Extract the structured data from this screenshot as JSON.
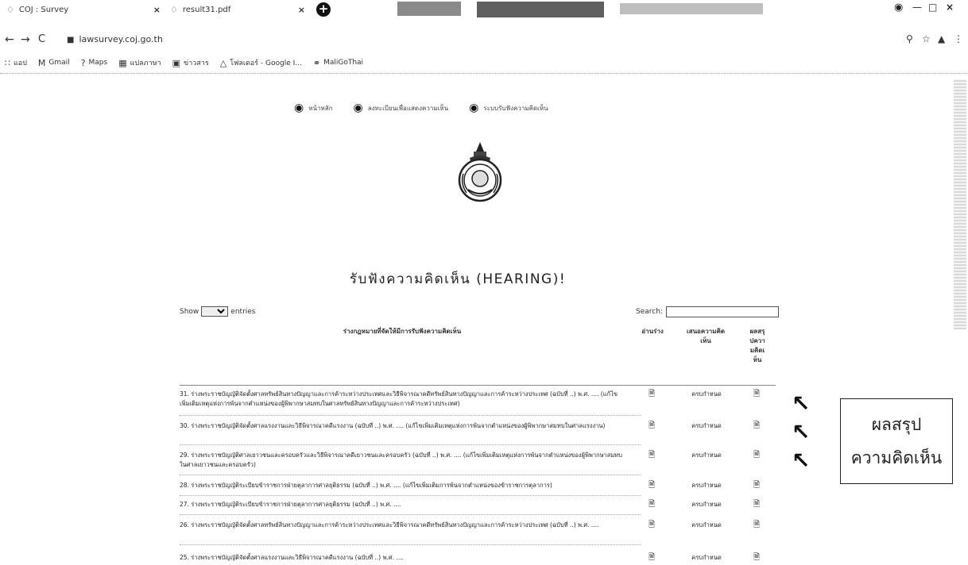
{
  "tabs": [
    {
      "label": "COJ : Survey"
    },
    {
      "label": "result31.pdf"
    }
  ],
  "address": {
    "url": "lawsurvey.coj.go.th"
  },
  "bookmarks": [
    {
      "label": "แอป"
    },
    {
      "label": "Gmail"
    },
    {
      "label": "Maps"
    },
    {
      "label": "แปลภาษา"
    },
    {
      "label": "ข่าวสาร"
    },
    {
      "label": "โฟลเดอร์ - Google I..."
    },
    {
      "label": "MaliGoThai"
    }
  ],
  "topnav": [
    {
      "label": "หน้าหลัก"
    },
    {
      "label": "ลงทะเบียนเพื่อแสดงความเห็น"
    },
    {
      "label": "ระบบรับฟังความคิดเห็น"
    }
  ],
  "page": {
    "title": "รับฟังความคิดเห็น (HEARING)!",
    "show_label": "Show",
    "entries_label": "entries",
    "search_label": "Search:"
  },
  "table": {
    "headers": {
      "name": "ร่างกฎหมายที่จัดให้มีการรับฟังความคิดเห็น",
      "draft": "อ่านร่าง",
      "status": "เสนอความคิดเห็น",
      "result": "ผลสรุปความคิดเห็น"
    },
    "rows": [
      {
        "text": "31. ร่างพระราชบัญญัติจัดตั้งศาลทรัพย์สินทางปัญญาและการค้าระหว่างประเทศและวิธีพิจารณาคดีทรัพย์สินทางปัญญาและการค้าระหว่างประเทศ (ฉบับที่ ..) พ.ศ. .... (แก้ไขเพิ่มเติมเหตุแห่งการพ้นจากตำแหน่งของผู้พิพากษาสมทบในศาลทรัพย์สินทางปัญญาและการค้าระหว่างประเทศ)",
        "status": "ครบกำหนด"
      },
      {
        "text": "30. ร่างพระราชบัญญัติจัดตั้งศาลแรงงานและวิธีพิจารณาคดีแรงงาน (ฉบับที่ ..) พ.ศ. .... (แก้ไขเพิ่มเติมเหตุแห่งการพ้นจากตำแหน่งของผู้พิพากษาสมทบในศาลแรงงาน)",
        "status": "ครบกำหนด"
      },
      {
        "text": "29. ร่างพระราชบัญญัติศาลเยาวชนและครอบครัวและวิธีพิจารณาคดีเยาวชนและครอบครัว (ฉบับที่ ..) พ.ศ. .... (แก้ไขเพิ่มเติมเหตุแห่งการพ้นจากตำแหน่งของผู้พิพากษาสมทบในศาลเยาวชนและครอบครัว)",
        "status": "ครบกำหนด"
      },
      {
        "text": "28. ร่างพระราชบัญญัติระเบียบข้าราชการฝ่ายตุลาการศาลยุติธรรม (ฉบับที่ ..) พ.ศ. .... (แก้ไขเพิ่มเติมการพ้นจากตำแหน่งของข้าราชการตุลาการ)",
        "status": "ครบกำหนด"
      },
      {
        "text": "27. ร่างพระราชบัญญัติระเบียบข้าราชการฝ่ายตุลาการศาลยุติธรรม (ฉบับที่ ..) พ.ศ. ....",
        "status": "ครบกำหนด"
      },
      {
        "text": "26. ร่างพระราชบัญญัติจัดตั้งศาลทรัพย์สินทางปัญญาและการค้าระหว่างประเทศและวิธีพิจารณาคดีทรัพย์สินทางปัญญาและการค้าระหว่างประเทศ (ฉบับที่ ..) พ.ศ. ....",
        "status": "ครบกำหนด"
      },
      {
        "text": "25. ร่างพระราชบัญญัติจัดตั้งศาลแรงงานและวิธีพิจารณาคดีแรงงาน (ฉบับที่ ..) พ.ศ. ....",
        "status": "ครบกำหนด"
      }
    ]
  },
  "callout": {
    "line1": "ผลสรุป",
    "line2": "ความคิดเห็น"
  }
}
